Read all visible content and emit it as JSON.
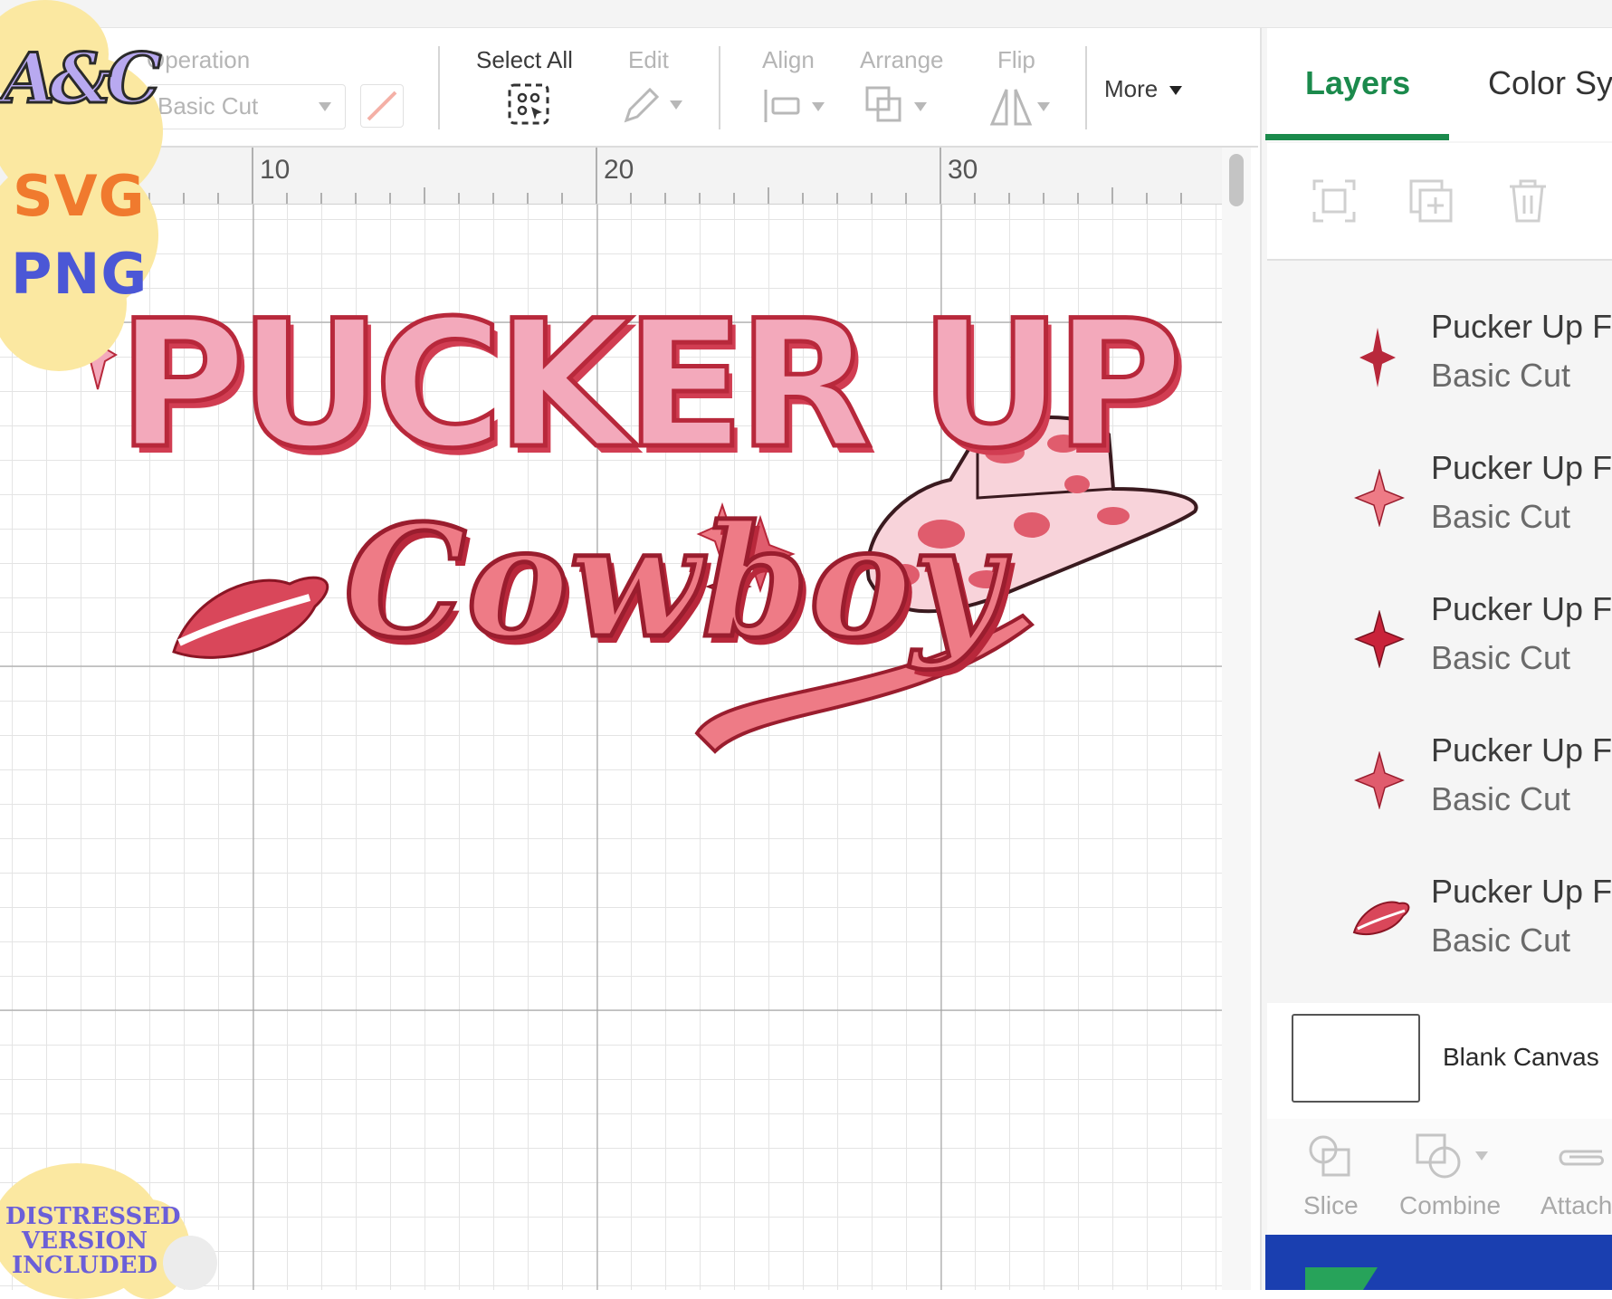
{
  "toolbar": {
    "operation_label": "Operation",
    "operation_value": "Basic Cut",
    "select_all_label": "Select All",
    "edit_label": "Edit",
    "align_label": "Align",
    "arrange_label": "Arrange",
    "flip_label": "Flip",
    "more_label": "More"
  },
  "ruler": {
    "ticks": [
      "10",
      "20",
      "30"
    ]
  },
  "design": {
    "title_line1": "PUCKER UP",
    "title_line2": "Cowboy"
  },
  "panel": {
    "tabs": [
      "Layers",
      "Color Sy"
    ],
    "active_tab": "Layers",
    "layers": [
      {
        "name": "Pucker Up F",
        "operation": "Basic Cut",
        "icon": "sparkle-icon"
      },
      {
        "name": "Pucker Up F",
        "operation": "Basic Cut",
        "icon": "sparkle-icon"
      },
      {
        "name": "Pucker Up F",
        "operation": "Basic Cut",
        "icon": "sparkle-icon"
      },
      {
        "name": "Pucker Up F",
        "operation": "Basic Cut",
        "icon": "sparkle-icon"
      },
      {
        "name": "Pucker Up F",
        "operation": "Basic Cut",
        "icon": "lips-icon"
      }
    ],
    "blank_canvas_label": "Blank Canvas",
    "bottom_tools": {
      "slice": "Slice",
      "combine": "Combine",
      "attach": "Attach"
    }
  },
  "badges": {
    "logo_text": "A&C",
    "svg_text": "SVG",
    "png_text": "PNG",
    "distressed_line1": "DISTRESSED",
    "distressed_line2": "VERSION",
    "distressed_line3": "INCLUDED"
  },
  "colors": {
    "accent_green": "#1b8a4c",
    "pink_light": "#f3a9bb",
    "pink_mid": "#ee7b86",
    "red_dark": "#b8283b",
    "badge_yellow": "#fbe8a1",
    "svg_orange": "#f07a2e",
    "png_blue": "#4b57d6"
  }
}
